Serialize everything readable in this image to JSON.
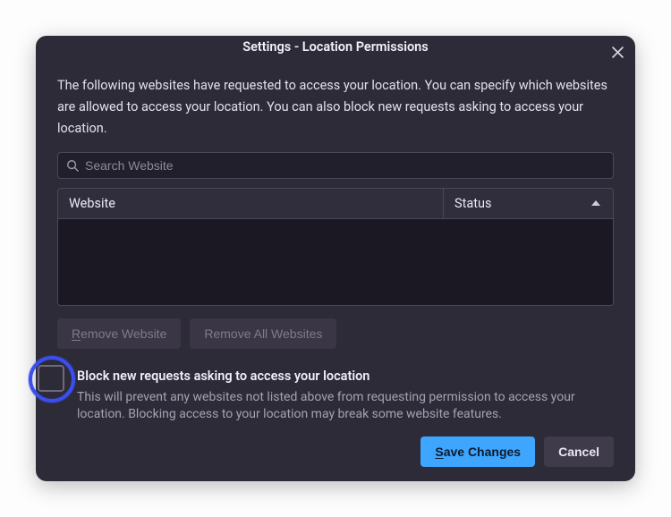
{
  "dialog": {
    "title": "Settings - Location Permissions",
    "description": "The following websites have requested to access your location. You can specify which websites are allowed to access your location. You can also block new requests asking to access your location.",
    "search_placeholder": "Search Website",
    "columns": {
      "website": "Website",
      "status": "Status"
    },
    "buttons": {
      "remove_one_prefix": "R",
      "remove_one_rest": "emove Website",
      "remove_all": "Remove All Websites",
      "save_prefix": "S",
      "save_rest": "ave Changes",
      "cancel": "Cancel"
    },
    "block": {
      "label": "Block new requests asking to access your location",
      "description": "This will prevent any websites not listed above from requesting permission to access your location. Blocking access to your location may break some website features.",
      "checked": false
    }
  }
}
